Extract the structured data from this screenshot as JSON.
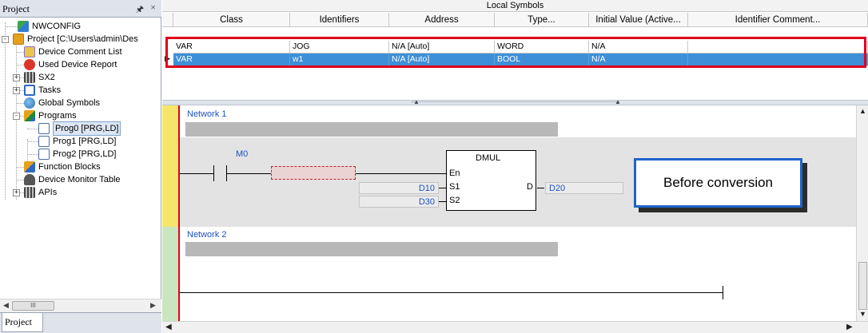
{
  "project_panel": {
    "title": "Project",
    "pin_icon": "\u0002",
    "close_icon": "×",
    "tree": [
      {
        "label": "NWCONFIG",
        "icon": "network-config-icon",
        "color": "#2d7bd4"
      },
      {
        "label": "Project [C:\\Users\\admin\\Des",
        "icon": "project-icon",
        "color": "#e6a11c"
      },
      {
        "label": "Device Comment List",
        "icon": "comment-list-icon",
        "color": "#6b52c8"
      },
      {
        "label": "Used Device Report",
        "icon": "device-report-icon",
        "color": "#d9362a"
      },
      {
        "label": "SX2",
        "icon": "plc-icon",
        "color": "#555555"
      },
      {
        "label": "Tasks",
        "icon": "tasks-icon",
        "color": "#2d68c4"
      },
      {
        "label": "Global Symbols",
        "icon": "global-symbols-icon",
        "color": "#3b82c9"
      },
      {
        "label": "Programs",
        "icon": "programs-icon",
        "color": "#e6a11c"
      },
      {
        "label": "Prog0 [PRG,LD]",
        "icon": "ld-program-icon",
        "color": "#4a6fa5"
      },
      {
        "label": "Prog1 [PRG,LD]",
        "icon": "ld-program-icon",
        "color": "#4a6fa5"
      },
      {
        "label": "Prog2 [PRG,LD]",
        "icon": "ld-program-icon",
        "color": "#4a6fa5"
      },
      {
        "label": "Function Blocks",
        "icon": "function-blocks-icon",
        "color": "#e6a11c"
      },
      {
        "label": "Device Monitor Table",
        "icon": "monitor-table-icon",
        "color": "#555555"
      },
      {
        "label": "APIs",
        "icon": "apis-icon",
        "color": "#555555"
      }
    ],
    "tab_label": "Project",
    "scroll_thumb_label": "III"
  },
  "symbols": {
    "title": "Local Symbols",
    "columns": [
      "Class",
      "Identifiers",
      "Address",
      "Type...",
      "Initial Value (Active...",
      "Identifier Comment..."
    ],
    "rows": [
      {
        "class": "VAR",
        "identifier": "JOG",
        "address": "N/A [Auto]",
        "type": "WORD",
        "initial": "N/A",
        "comment": ""
      },
      {
        "class": "VAR",
        "identifier": "w1",
        "address": "N/A [Auto]",
        "type": "BOOL",
        "initial": "N/A",
        "comment": ""
      }
    ],
    "row_indicator": "▶"
  },
  "editor": {
    "network1": {
      "title": "Network 1"
    },
    "network2": {
      "title": "Network 2"
    },
    "contact": {
      "label": "M0"
    },
    "instruction": {
      "name": "DMUL",
      "pin_en": "En",
      "pin_s1": "S1",
      "pin_s2": "S2",
      "pin_d": "D",
      "operand_s1": "D10",
      "operand_s2": "D30",
      "operand_d": "D20"
    },
    "callout": "Before conversion"
  },
  "colors": {
    "highlight": "#e0001b",
    "selection": "#3d8fd7",
    "operand_text": "#1d52c3",
    "rung_bg": "#e3e3e3",
    "gutter_yellow": "#f5e66a",
    "gutter_green": "#c9e6c0"
  }
}
